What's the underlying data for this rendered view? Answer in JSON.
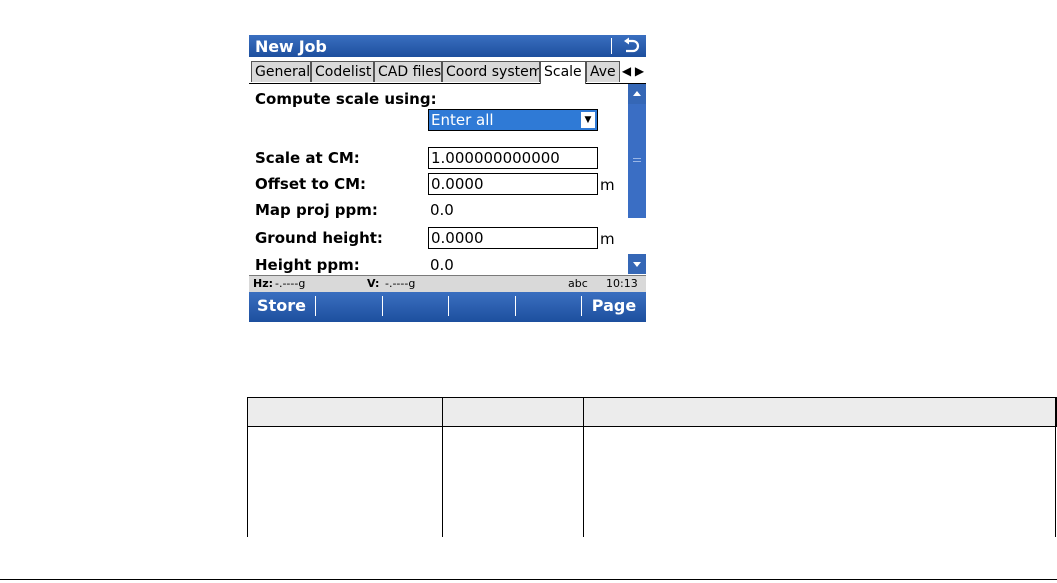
{
  "window": {
    "title": "New Job",
    "back_icon": "undo-arrow-icon"
  },
  "tabs": [
    {
      "label": "General",
      "active": false
    },
    {
      "label": "Codelist",
      "active": false
    },
    {
      "label": "CAD files",
      "active": false
    },
    {
      "label": "Coord system",
      "active": false
    },
    {
      "label": "Scale",
      "active": true
    },
    {
      "label": "Ave",
      "active": false
    }
  ],
  "form": {
    "compute_label": "Compute scale using:",
    "compute_value": "Enter all",
    "scale_cm_label": "Scale at CM:",
    "scale_cm_value": "1.000000000000",
    "offset_cm_label": "Offset to CM:",
    "offset_cm_value": "0.0000",
    "offset_cm_unit": "m",
    "map_proj_label": "Map proj ppm:",
    "map_proj_value": "0.0",
    "ground_height_label": "Ground height:",
    "ground_height_value": "0.0000",
    "ground_height_unit": "m",
    "height_ppm_label": "Height ppm:",
    "height_ppm_value": "0.0"
  },
  "status": {
    "hz_label": "Hz:",
    "hz_value": "-.----g",
    "v_label": "V:",
    "v_value": "-.----g",
    "input_mode": "abc",
    "time": "10:13"
  },
  "softkeys": {
    "f1": "Store",
    "f6": "Page"
  },
  "colors": {
    "titlebar": "#2a5cae",
    "selection": "#2f7ad6",
    "tab_inactive": "#d9d9d9"
  }
}
